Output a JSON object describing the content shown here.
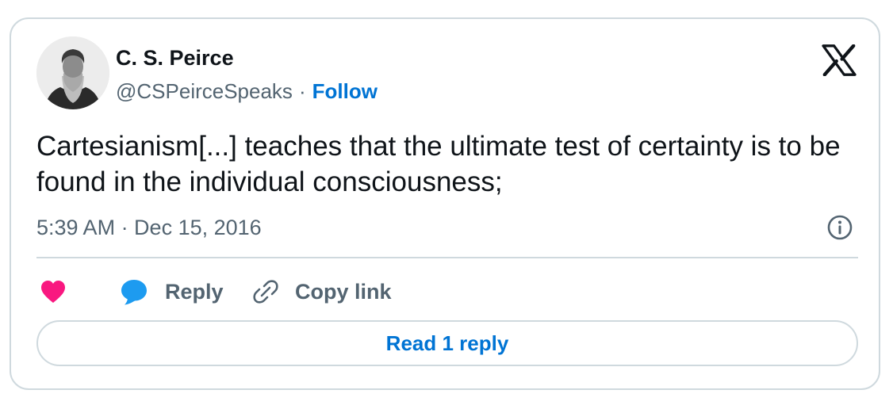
{
  "author": {
    "name": "C. S. Peirce",
    "handle": "@CSPeirceSpeaks",
    "separator": "·",
    "follow_label": "Follow",
    "avatar_icon": "portrait-avatar"
  },
  "tweet": {
    "text": "Cartesianism[...] teaches that the ultimate test of certainty is to be found in the individual consciousness;",
    "timestamp": "5:39 AM · Dec 15, 2016"
  },
  "actions": {
    "like_icon": "heart-icon",
    "reply_label": "Reply",
    "copy_link_label": "Copy link"
  },
  "footer": {
    "read_replies_label": "Read 1 reply"
  },
  "colors": {
    "accent": "#0074d4",
    "heart": "#f91880",
    "reply_bubble": "#1d9bf0",
    "muted_text": "#536471",
    "border": "#cfd9de"
  }
}
